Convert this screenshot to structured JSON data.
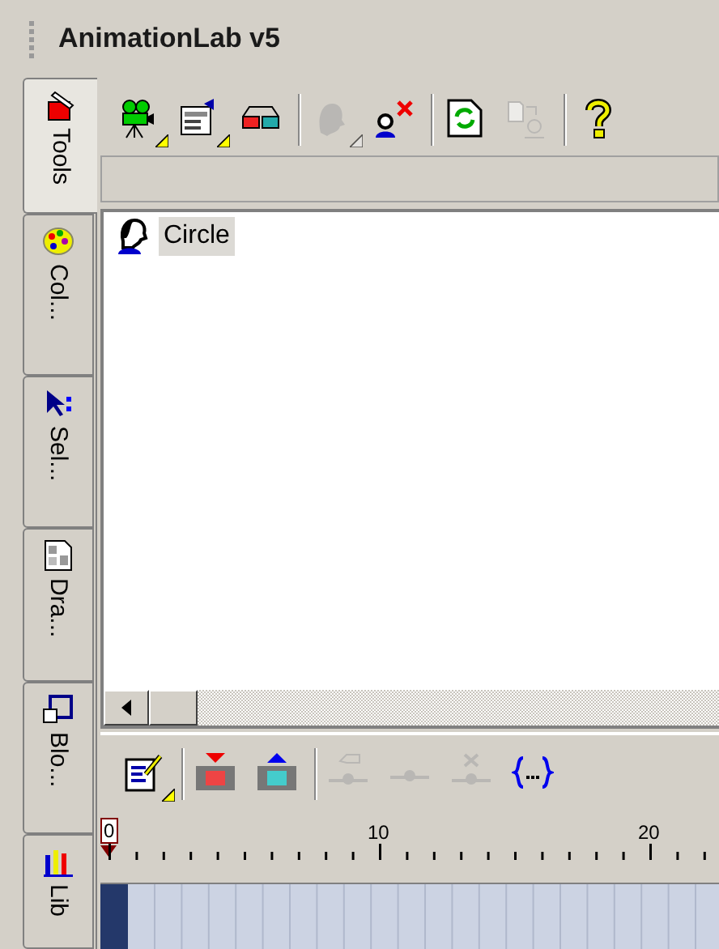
{
  "window": {
    "title": "AnimationLab v5"
  },
  "side_tabs": [
    {
      "label": "Tools",
      "kind": "tools",
      "selected": true
    },
    {
      "label": "Col...",
      "kind": "palette",
      "selected": false
    },
    {
      "label": "Sel...",
      "kind": "pointer",
      "selected": false
    },
    {
      "label": "Dra...",
      "kind": "drawing",
      "selected": false
    },
    {
      "label": "Blo...",
      "kind": "block",
      "selected": false
    },
    {
      "label": "Lib",
      "kind": "library",
      "selected": false
    }
  ],
  "toolbar": [
    {
      "kind": "camera",
      "disabled": false,
      "dropdown": true
    },
    {
      "kind": "clipboard",
      "disabled": false,
      "dropdown": true
    },
    {
      "kind": "glasses",
      "disabled": false,
      "dropdown": false
    },
    {
      "kind": "separator"
    },
    {
      "kind": "face",
      "disabled": true,
      "dropdown": true
    },
    {
      "kind": "person-delete",
      "disabled": false,
      "dropdown": false
    },
    {
      "kind": "separator"
    },
    {
      "kind": "refresh",
      "disabled": false,
      "dropdown": false
    },
    {
      "kind": "swap",
      "disabled": true,
      "dropdown": false
    },
    {
      "kind": "separator"
    },
    {
      "kind": "help",
      "disabled": false,
      "dropdown": false
    }
  ],
  "tree": {
    "items": [
      {
        "label": "Circle",
        "selected": true
      }
    ]
  },
  "timeline_toolbar": [
    {
      "kind": "edit",
      "disabled": false,
      "dropdown": true
    },
    {
      "kind": "separator"
    },
    {
      "kind": "film-down",
      "disabled": false,
      "dropdown": false
    },
    {
      "kind": "film-up",
      "disabled": false,
      "dropdown": false
    },
    {
      "kind": "separator"
    },
    {
      "kind": "key-arrow",
      "disabled": true,
      "dropdown": false
    },
    {
      "kind": "key",
      "disabled": true,
      "dropdown": false
    },
    {
      "kind": "key-delete",
      "disabled": true,
      "dropdown": false
    },
    {
      "kind": "braces",
      "disabled": false,
      "dropdown": false
    }
  ],
  "ruler": {
    "marker": "0",
    "labels": [
      "10",
      "20"
    ]
  }
}
